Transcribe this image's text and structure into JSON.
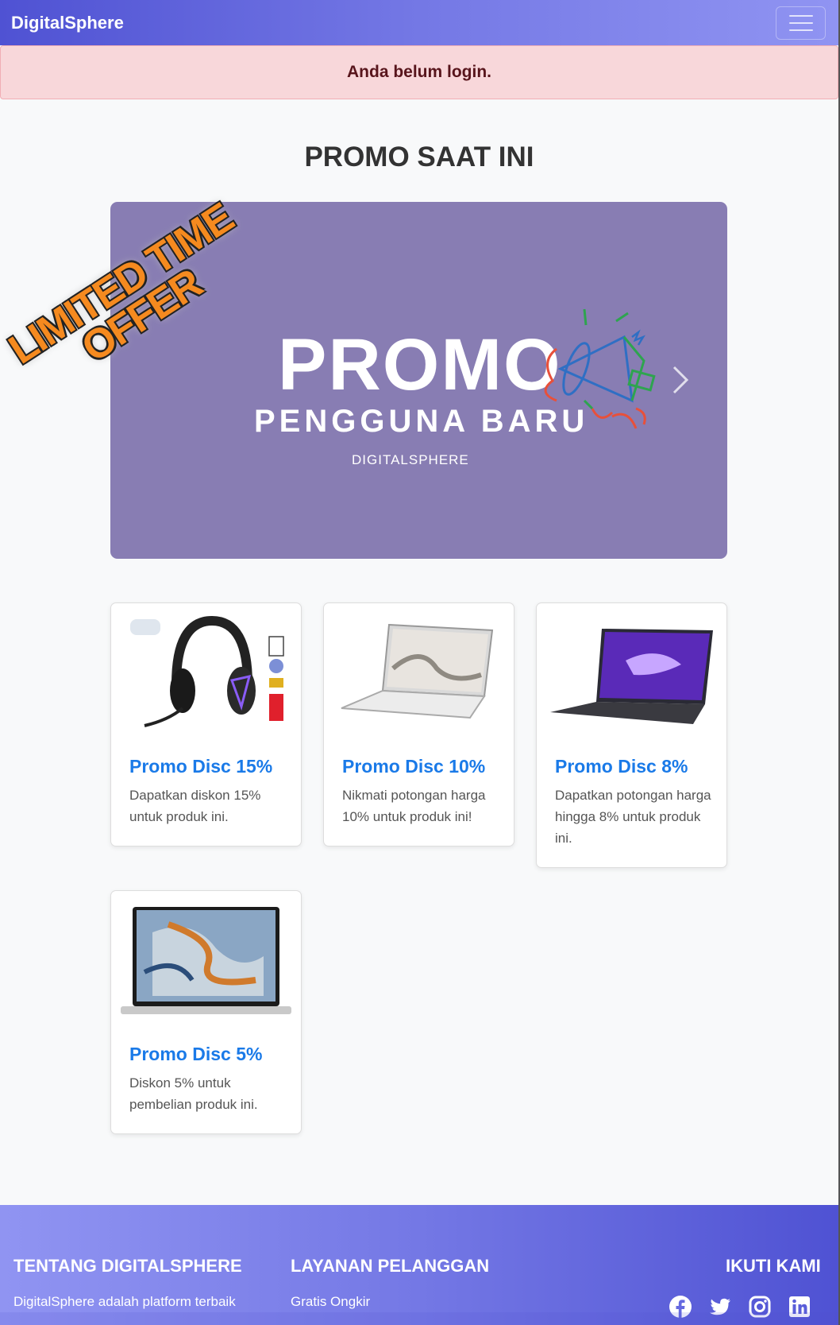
{
  "navbar": {
    "brand": "DigitalSphere",
    "toggle_icon": "hamburger-menu-icon"
  },
  "alert": {
    "text": "Anda belum login.",
    "color": "#f8d7da"
  },
  "page_title": "PROMO SAAT INI",
  "carousel": {
    "badge_line1": "LIMITED TIME",
    "badge_line2": "OFFER",
    "headline": "PROMO",
    "subheadline": "PENGGUNA BARU",
    "brand": "DIGITALSPHERE",
    "background": "#887db3"
  },
  "promos": [
    {
      "title": "Promo Disc 15%",
      "description": "Dapatkan diskon 15% untuk produk ini.",
      "image": "gaming-headset"
    },
    {
      "title": "Promo Disc 10%",
      "description": "Nikmati potongan harga 10% untuk produk ini!",
      "image": "silver-laptop"
    },
    {
      "title": "Promo Disc 8%",
      "description": "Dapatkan potongan harga hingga 8% untuk produk ini.",
      "image": "gaming-laptop"
    },
    {
      "title": "Promo Disc 5%",
      "description": "Diskon 5% untuk pembelian produk ini.",
      "image": "ultrabook-laptop"
    }
  ],
  "footer": {
    "about_title": "TENTANG DIGITALSPHERE",
    "about_text": "DigitalSphere adalah platform terbaik",
    "service_title": "LAYANAN PELANGGAN",
    "service_item": "Gratis Ongkir",
    "follow_title": "IKUTI KAMI",
    "social_icons": [
      "facebook-icon",
      "twitter-icon",
      "instagram-icon",
      "linkedin-icon"
    ]
  },
  "colors": {
    "accent": "#1a7ae8",
    "nav_start": "#4f52d3",
    "nav_end": "#9094f2"
  }
}
